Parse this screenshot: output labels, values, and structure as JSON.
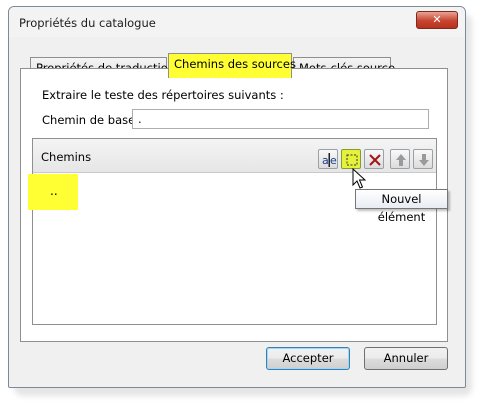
{
  "window": {
    "title": "Propriétés du catalogue",
    "close_label": "✕"
  },
  "tabs": [
    {
      "label": "Propriétés de traduction",
      "active": false
    },
    {
      "label": "Chemins des sources",
      "active": true
    },
    {
      "label": "Mots-clés source",
      "active": false
    }
  ],
  "panel": {
    "instruction": "Extraire le teste des répertoires suivants :",
    "base_path_label": "Chemin de base :",
    "base_path_value": "."
  },
  "paths_list": {
    "header": "Chemins",
    "items": [
      ".."
    ],
    "toolbar": [
      "rename-icon",
      "new-item-icon",
      "delete-icon",
      "move-up-icon",
      "move-down-icon"
    ]
  },
  "tooltip": "Nouvel élément",
  "buttons": {
    "accept": "Accepter",
    "cancel": "Annuler"
  },
  "colors": {
    "highlight": "#ffff33",
    "close_red": "#c7432f"
  }
}
